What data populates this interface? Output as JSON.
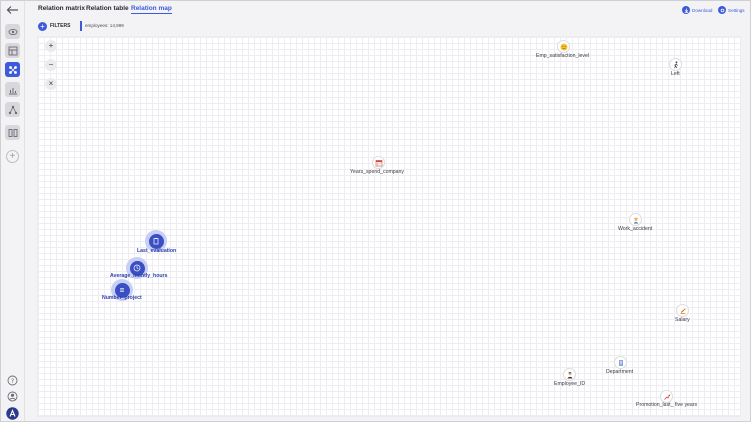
{
  "tabs": [
    {
      "label": "Relation matrix"
    },
    {
      "label": "Relation table"
    },
    {
      "label": "Relation map"
    }
  ],
  "top_actions": {
    "download": "Download",
    "settings": "Settings"
  },
  "filter": {
    "label": "FILTERS",
    "chip": "employees: 14,999"
  },
  "zoom": {
    "in": "+",
    "out": "−",
    "reset": "×"
  },
  "sidebar": {
    "add": "+"
  },
  "nodes": [
    {
      "label": "Emp_satisfaction_level",
      "icon": "smiley-icon",
      "highlighted": false
    },
    {
      "label": "Left",
      "icon": "walking-person-icon",
      "highlighted": false
    },
    {
      "label": "Years_spend_company",
      "icon": "calendar-icon",
      "highlighted": false
    },
    {
      "label": "Work_accident",
      "icon": "worker-icon",
      "highlighted": false
    },
    {
      "label": "Last_evaluation",
      "icon": "clipboard-icon",
      "highlighted": true
    },
    {
      "label": "Average_montly_hours",
      "icon": "clock-icon",
      "highlighted": true
    },
    {
      "label": "Number_project",
      "icon": "list-icon",
      "highlighted": true
    },
    {
      "label": "Salary",
      "icon": "money-icon",
      "highlighted": false
    },
    {
      "label": "Department",
      "icon": "building-icon",
      "highlighted": false
    },
    {
      "label": "Employee_ID",
      "icon": "person-icon",
      "highlighted": false
    },
    {
      "label": "Promotion_last_ five years",
      "icon": "trend-up-icon",
      "highlighted": false
    }
  ],
  "colors": {
    "accent": "#3b5bdb",
    "highlight_node": "#3b4fc4",
    "halo": "#c7cff5"
  }
}
